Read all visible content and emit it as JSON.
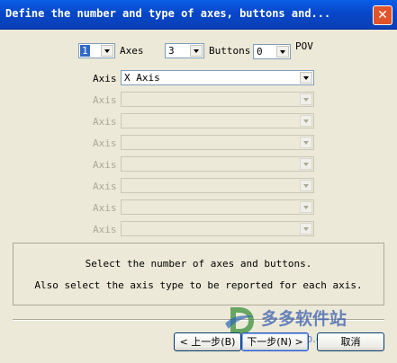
{
  "window": {
    "title": "Define the number and type of axes, buttons and...",
    "close_glyph": "✕"
  },
  "counts": {
    "axes_value": "1",
    "axes_label": "Axes",
    "buttons_value": "3",
    "buttons_label": "Buttons",
    "pov_value": "0",
    "pov_label": "POV"
  },
  "axes": [
    {
      "label": "Axis",
      "value": "X Axis",
      "enabled": true
    },
    {
      "label": "Axis",
      "value": "",
      "enabled": false
    },
    {
      "label": "Axis",
      "value": "",
      "enabled": false
    },
    {
      "label": "Axis",
      "value": "",
      "enabled": false
    },
    {
      "label": "Axis",
      "value": "",
      "enabled": false
    },
    {
      "label": "Axis",
      "value": "",
      "enabled": false
    },
    {
      "label": "Axis",
      "value": "",
      "enabled": false
    },
    {
      "label": "Axis",
      "value": "",
      "enabled": false
    }
  ],
  "info": {
    "line1": "Select the number of axes and buttons.",
    "line2": "Also select the axis type to be reported for each axis."
  },
  "buttons": {
    "back": "< 上一步(B)",
    "next": "下一步(N) >",
    "cancel": "取消"
  },
  "watermark": {
    "name": "多多软件站",
    "url": "ddooo.com"
  }
}
